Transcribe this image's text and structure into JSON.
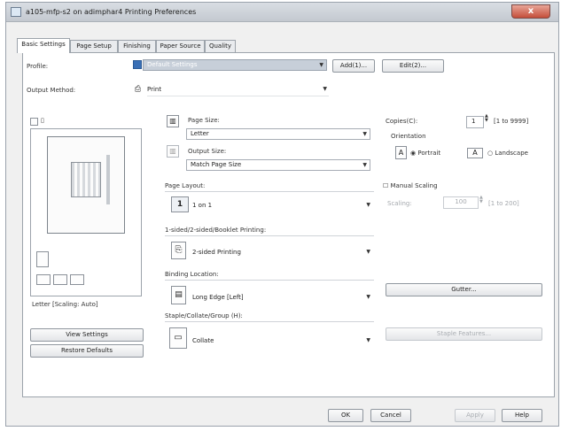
{
  "window": {
    "title": "a105-mfp-s2 on adimphar4 Printing Preferences",
    "close_label": "x"
  },
  "tabs": [
    {
      "label": "Basic Settings",
      "active": true
    },
    {
      "label": "Page Setup",
      "active": false
    },
    {
      "label": "Finishing",
      "active": false
    },
    {
      "label": "Paper Source",
      "active": false
    },
    {
      "label": "Quality",
      "active": false
    }
  ],
  "profile": {
    "label": "Profile:",
    "value": "Default Settings",
    "add_label": "Add(1)...",
    "edit_label": "Edit(2)..."
  },
  "output_method": {
    "label": "Output Method:",
    "value": "Print"
  },
  "page_size": {
    "label": "Page Size:",
    "value": "Letter"
  },
  "output_size": {
    "label": "Output Size:",
    "value": "Match Page Size"
  },
  "page_layout": {
    "label": "Page Layout:",
    "icon_value": "1",
    "value": "1 on 1"
  },
  "sided": {
    "label": "1-sided/2-sided/Booklet Printing:",
    "value": "2-sided Printing"
  },
  "binding": {
    "label": "Binding Location:",
    "value": "Long Edge [Left]"
  },
  "staple": {
    "label": "Staple/Collate/Group (H):",
    "value": "Collate"
  },
  "copies": {
    "label": "Copies(C):",
    "value": "1",
    "range": "[1 to 9999]"
  },
  "orientation": {
    "label": "Orientation",
    "portrait": "Portrait",
    "landscape": "Landscape",
    "portrait_letter": "A",
    "landscape_letter": "A"
  },
  "manual_scaling": {
    "label": "Manual Scaling",
    "scaling_label": "Scaling:",
    "value": "100",
    "range": "[1 to 200]"
  },
  "gutter_label": "Gutter...",
  "staple_features_label": "Staple Features...",
  "preview": {
    "caption": "Letter [Scaling: Auto]"
  },
  "view_settings_label": "View Settings",
  "restore_defaults_label": "Restore Defaults",
  "footer": {
    "ok": "OK",
    "cancel": "Cancel",
    "apply": "Apply",
    "help": "Help"
  }
}
